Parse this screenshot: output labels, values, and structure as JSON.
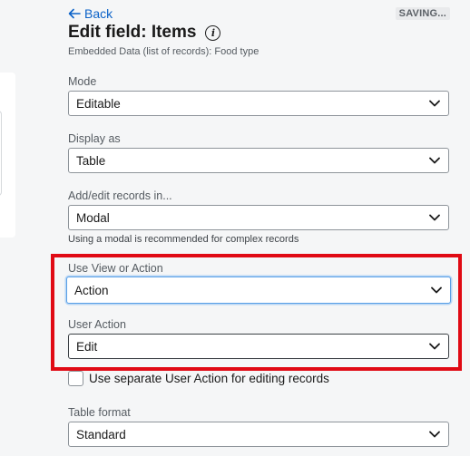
{
  "header": {
    "back_label": "Back",
    "saving_badge": "SAVING...",
    "title": "Edit field: Items",
    "info_icon": "info-icon",
    "subtitle": "Embedded Data (list of records): Food type"
  },
  "fields": {
    "mode": {
      "label": "Mode",
      "value": "Editable"
    },
    "display_as": {
      "label": "Display as",
      "value": "Table"
    },
    "add_edit_in": {
      "label": "Add/edit records in...",
      "value": "Modal",
      "hint": "Using a modal is recommended for complex records"
    },
    "use_view_or_action": {
      "label": "Use View or Action",
      "value": "Action"
    },
    "user_action": {
      "label": "User Action",
      "value": "Edit"
    },
    "separate_action": {
      "label": "Use separate User Action for editing records",
      "checked": false
    },
    "table_format": {
      "label": "Table format",
      "value": "Standard"
    }
  },
  "colors": {
    "accent": "#0b62c8",
    "highlight": "#e00a14",
    "focus_ring": "#5aa0e6"
  }
}
